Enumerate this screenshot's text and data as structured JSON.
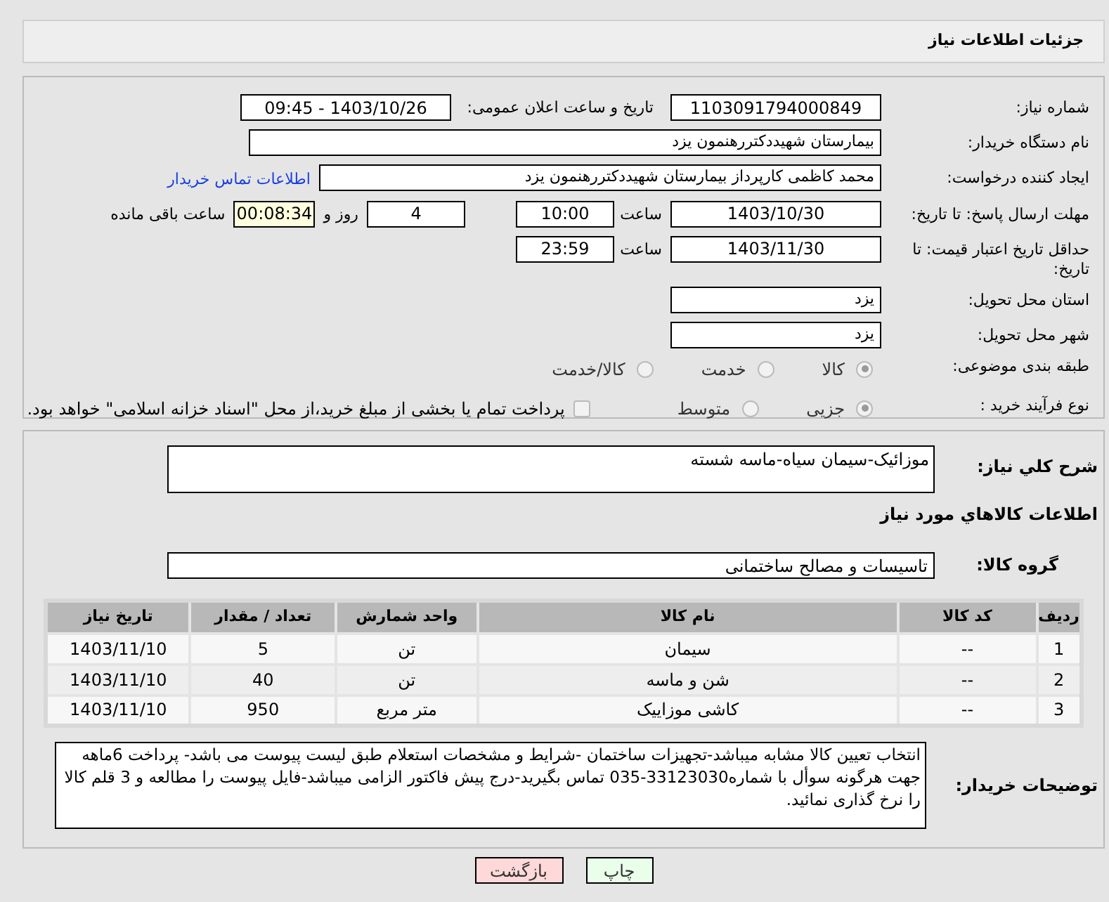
{
  "header": {
    "title": "جزئیات اطلاعات نیاز"
  },
  "need_number": {
    "label": "شماره نیاز:",
    "value": "1103091794000849"
  },
  "announce": {
    "label": "تاریخ و ساعت اعلان عمومی:",
    "value": "1403/10/26 - 09:45"
  },
  "buyer_org": {
    "label": "نام دستگاه خریدار:",
    "value": "بیمارستان شهیددکتررهنمون یزد"
  },
  "requester": {
    "label": "ایجاد کننده درخواست:",
    "value": "محمد کاظمی کارپرداز بیمارستان شهیددکتررهنمون یزد",
    "link": "اطلاعات تماس خریدار"
  },
  "deadline": {
    "label": "مهلت ارسال پاسخ: تا تاریخ:",
    "date": "1403/10/30",
    "time_label": "ساعت",
    "time": "10:00",
    "days": "4",
    "days_label": "روز و",
    "remaining": "00:08:34",
    "remaining_label": "ساعت باقی مانده"
  },
  "validity": {
    "label": "حداقل تاریخ اعتبار قیمت: تا تاریخ:",
    "date": "1403/11/30",
    "time_label": "ساعت",
    "time": "23:59"
  },
  "province": {
    "label": "استان محل تحویل:",
    "value": "یزد"
  },
  "city": {
    "label": "شهر محل تحویل:",
    "value": "یزد"
  },
  "category": {
    "label": "طبقه بندی موضوعی:",
    "options": [
      {
        "label": "کالا",
        "selected": true
      },
      {
        "label": "خدمت",
        "selected": false
      },
      {
        "label": "کالا/خدمت",
        "selected": false
      }
    ]
  },
  "process": {
    "label": "نوع فرآیند خرید :",
    "options": [
      {
        "label": "جزیی",
        "selected": true
      },
      {
        "label": "متوسط",
        "selected": false
      }
    ],
    "treasury": {
      "label": "پرداخت تمام یا بخشی از مبلغ خرید،از محل \"اسناد خزانه اسلامی\" خواهد بود.",
      "checked": false
    }
  },
  "summary": {
    "label": "شرح کلي نیاز:",
    "value": "موزائیک-سیمان سیاه-ماسه شسته"
  },
  "goods_heading": "اطلاعات کالاهاي مورد نیاز",
  "goods_group": {
    "label": "گروه کالا:",
    "value": "تاسیسات و مصالح ساختمانی"
  },
  "table": {
    "columns": [
      "ردیف",
      "کد کالا",
      "نام کالا",
      "واحد شمارش",
      "تعداد / مقدار",
      "تاریخ نیاز"
    ],
    "rows": [
      [
        "1",
        "--",
        "سیمان",
        "تن",
        "5",
        "1403/11/10"
      ],
      [
        "2",
        "--",
        "شن و ماسه",
        "تن",
        "40",
        "1403/11/10"
      ],
      [
        "3",
        "--",
        "کاشی موزاییک",
        "متر مربع",
        "950",
        "1403/11/10"
      ]
    ]
  },
  "buyer_notes": {
    "label": "توضیحات خریدار:",
    "value": "انتخاب تعیین کالا مشابه میباشد-تجهیزات ساختمان -شرایط و مشخصات استعلام طبق لیست پیوست می باشد- پرداخت 6ماهه جهت هرگونه سوأل با شماره33123030-035 تماس بگیرید-درج پیش فاکتور الزامی میباشد-فایل پیوست را مطالعه و 3 قلم کالا را نرخ گذاری نمائید."
  },
  "buttons": [
    {
      "label": "چاپ",
      "kind": "print"
    },
    {
      "label": "بازگشت",
      "kind": "back"
    }
  ]
}
